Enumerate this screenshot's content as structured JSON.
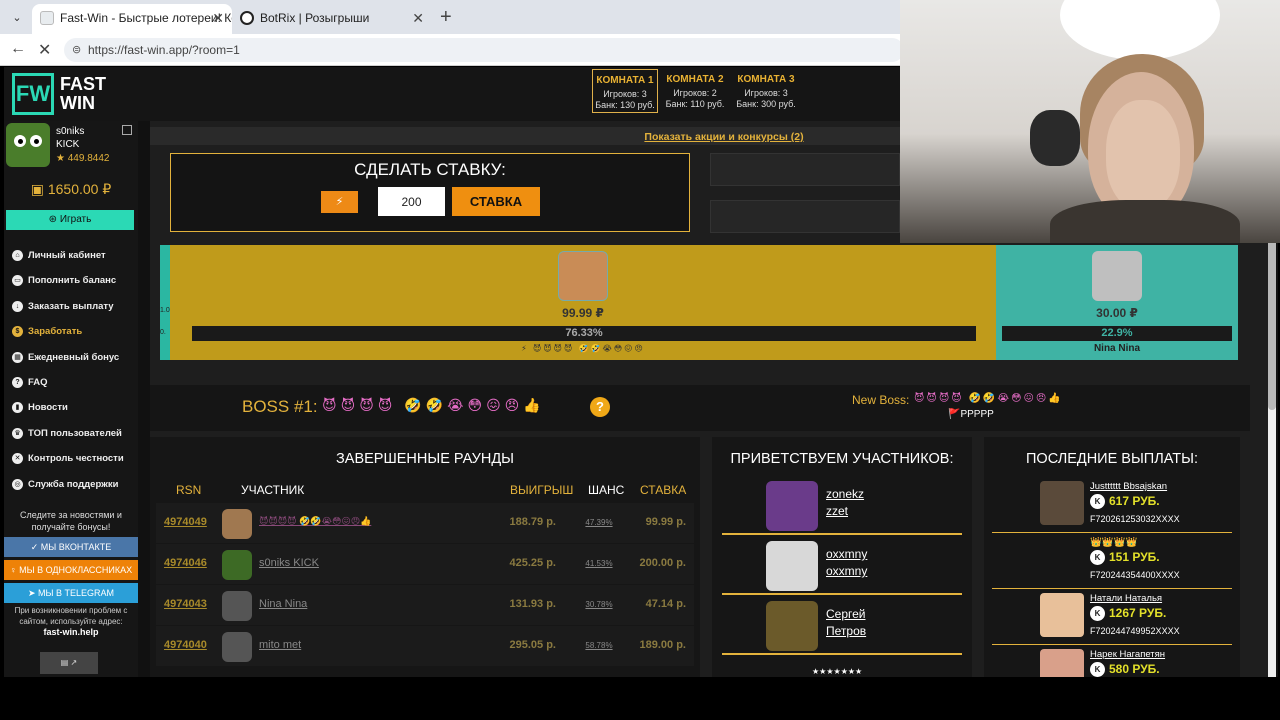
{
  "browser": {
    "tabs": [
      {
        "title": "Fast-Win - Быстрые лотереи! Ком"
      },
      {
        "title": "BotRix | Розыгрыши"
      }
    ],
    "url": "https://fast-win.app/?room=1"
  },
  "header": {
    "logo_mark": "FW",
    "logo_line1": "FAST",
    "logo_line2": "WIN",
    "rooms": [
      {
        "name": "КОМНАТА 1",
        "players": "Игроков: 3",
        "bank": "Банк: 130 руб."
      },
      {
        "name": "КОМНАТА 2",
        "players": "Игроков: 2",
        "bank": "Банк: 110 руб."
      },
      {
        "name": "КОМНАТА 3",
        "players": "Игроков: 3",
        "bank": "Банк: 300 руб."
      }
    ]
  },
  "user": {
    "name_line1": "s0niks",
    "name_line2": "KICK",
    "score": "★ 449.8442",
    "balance": "1650.00 ₽",
    "play_label": "Играть"
  },
  "sidebar": {
    "items": [
      {
        "label": "Личный кабинет"
      },
      {
        "label": "Пополнить баланс"
      },
      {
        "label": "Заказать выплату"
      },
      {
        "label": "Заработать"
      },
      {
        "label": "Ежедневный бонус"
      },
      {
        "label": "FAQ"
      },
      {
        "label": "Новости"
      },
      {
        "label": "ТОП пользователей"
      },
      {
        "label": "Контроль честности"
      },
      {
        "label": "Служба поддержки"
      }
    ],
    "follow_text": "Следите за новостями и получайте бонусы!",
    "vk": "МЫ ВКОНТАКТЕ",
    "ok": "МЫ В ОДНОКЛАССНИКАХ",
    "tg": "МЫ В TELEGRAM",
    "support_text": "При возникновении проблем с сайтом, используйте адрес:",
    "support_domain": "fast-win.help"
  },
  "promo": {
    "link": "Показать акции и конкурсы (2)"
  },
  "bet": {
    "title": "СДЕЛАТЬ СТАВКУ:",
    "amount": "200",
    "button": "СТАВКА"
  },
  "game": {
    "left_ticks": [
      "1.0",
      "0."
    ],
    "p1": {
      "amount": "99.99 ₽",
      "percent": "76.33%",
      "emojis": "⚡ 😈😈😈😈 🤣🤣😭😳😖😠"
    },
    "p2": {
      "amount": "30.00 ₽",
      "percent": "22.9%",
      "name": "Nina Nina"
    }
  },
  "boss": {
    "title": "BOSS #1:",
    "emojis": "😈😈😈😈 🤣🤣😭😳😖😠👍",
    "help": "?",
    "new_label": "New Boss:",
    "new_emojis": "😈😈😈😈 🤣🤣😭😳😖😠👍",
    "new_sub": "🚩PPPPP"
  },
  "rounds": {
    "title": "ЗАВЕРШЕННЫЕ РАУНДЫ",
    "headers": {
      "id": "RSN",
      "player": "УЧАСТНИК",
      "win": "ВЫИГРЫШ",
      "chance": "ШАНС",
      "bet": "СТАВКА"
    },
    "rows": [
      {
        "id": "4974049",
        "name": "😈😈😈😈 🤣🤣😭😳😖😠👍",
        "win": "188.79 р.",
        "chance": "47.39%",
        "bet": "99.99 р."
      },
      {
        "id": "4974046",
        "name": "s0niks KICK",
        "win": "425.25 р.",
        "chance": "41.53%",
        "bet": "200.00 р."
      },
      {
        "id": "4974043",
        "name": "Nina Nina",
        "win": "131.93 р.",
        "chance": "30.78%",
        "bet": "47.14 р."
      },
      {
        "id": "4974040",
        "name": "mito met",
        "win": "295.05 р.",
        "chance": "58.78%",
        "bet": "189.00 р."
      }
    ]
  },
  "welcome": {
    "title": "ПРИВЕТСТВУЕМ УЧАСТНИКОВ:",
    "rows": [
      {
        "line1": "zonekz",
        "line2": "zzet"
      },
      {
        "line1": "oxxmny",
        "line2": "oxxmny"
      },
      {
        "line1": "Сергей",
        "line2": "Петров"
      }
    ],
    "more": "★★★★★★★"
  },
  "payouts": {
    "title": "ПОСЛЕДНИЕ ВЫПЛАТЫ:",
    "rows": [
      {
        "name": "Justttttt Bbsajskan",
        "amount": "617 РУБ.",
        "card": "F720261253032XXXX"
      },
      {
        "name": "👑👑👑👑",
        "amount": "151 РУБ.",
        "card": "F720244354400XXXX"
      },
      {
        "name": "Натали Наталья",
        "amount": "1267 РУБ.",
        "card": "F720244749952XXXX"
      },
      {
        "name": "Нарек Нагапетян",
        "amount": "580 РУБ.",
        "card": ""
      }
    ]
  },
  "colors": {
    "accent": "#e3b23c",
    "teal": "#2bd9b5",
    "game_gold": "#c09b1b",
    "game_teal": "#3fb3a4"
  }
}
